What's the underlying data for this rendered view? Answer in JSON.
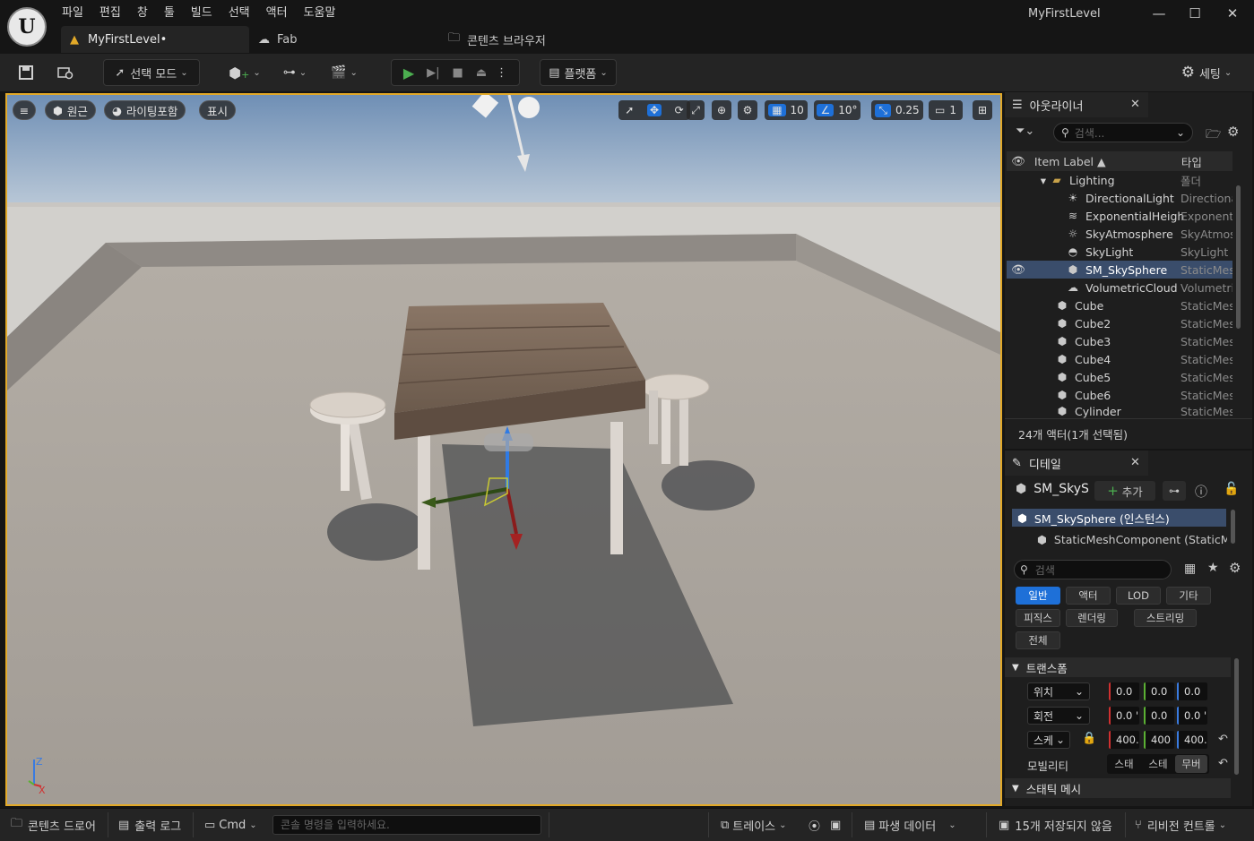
{
  "menu": [
    "파일",
    "편집",
    "창",
    "툴",
    "빌드",
    "선택",
    "액터",
    "도움말"
  ],
  "tabs": {
    "level": "MyFirstLevel•",
    "fab": "Fab",
    "content_browser": "콘텐츠 브라우저"
  },
  "window_title": "MyFirstLevel",
  "window_buttons": {
    "minimize": "—",
    "maximize": "☐",
    "close": "✕"
  },
  "toolbar": {
    "select_mode": "선택 모드",
    "platform": "플랫폼",
    "settings": "세팅"
  },
  "viewport": {
    "perspective": "원근",
    "lighting": "라이팅포함",
    "show": "표시",
    "grid_snap": "10",
    "rotate_snap": "10°",
    "scale_snap": "0.25",
    "camera_speed": "1",
    "axis_z": "Z",
    "axis_x": "X"
  },
  "outliner": {
    "title": "아웃라이너",
    "search_placeholder": "검색...",
    "col_label": "Item Label ▲",
    "col_type": "타입",
    "rows": [
      {
        "label": "Lighting",
        "type": "폴더",
        "icon": "folder-icon"
      },
      {
        "label": "DirectionalLight",
        "type": "Directiona",
        "icon": "sun-icon"
      },
      {
        "label": "ExponentialHeigh",
        "type": "Exponenti",
        "icon": "fog-icon"
      },
      {
        "label": "SkyAtmosphere",
        "type": "SkyAtmos",
        "icon": "atmosphere-icon"
      },
      {
        "label": "SkyLight",
        "type": "SkyLight",
        "icon": "skylight-icon"
      },
      {
        "label": "SM_SkySphere",
        "type": "StaticMes",
        "icon": "mesh-icon",
        "selected": true
      },
      {
        "label": "VolumetricCloud",
        "type": "Volumetric",
        "icon": "cloud-icon"
      },
      {
        "label": "Cube",
        "type": "StaticMes",
        "icon": "mesh-icon"
      },
      {
        "label": "Cube2",
        "type": "StaticMes",
        "icon": "mesh-icon"
      },
      {
        "label": "Cube3",
        "type": "StaticMes",
        "icon": "mesh-icon"
      },
      {
        "label": "Cube4",
        "type": "StaticMes",
        "icon": "mesh-icon"
      },
      {
        "label": "Cube5",
        "type": "StaticMes",
        "icon": "mesh-icon"
      },
      {
        "label": "Cube6",
        "type": "StaticMes",
        "icon": "mesh-icon"
      },
      {
        "label": "Cylinder",
        "type": "StaticMes",
        "icon": "mesh-icon"
      }
    ],
    "footer": "24개 액터(1개 선택됨)"
  },
  "details": {
    "title": "디테일",
    "actor_name": "SM_SkyS",
    "add_label": "추가",
    "instance": "SM_SkySphere (인스턴스)",
    "component": "StaticMeshComponent (StaticMe",
    "search_placeholder": "검색",
    "filters": [
      "일반",
      "액터",
      "LOD",
      "기타",
      "피직스",
      "렌더링",
      "스트리밍",
      "전체"
    ],
    "transform_section": "트랜스폼",
    "location_label": "위치",
    "rotation_label": "회전",
    "scale_label": "스케",
    "location": [
      "0.0",
      "0.0",
      "0.0"
    ],
    "rotation": [
      "0.0 '",
      "0.0",
      "0.0 '"
    ],
    "scale": [
      "400.",
      "400",
      "400."
    ],
    "mobility_label": "모빌리티",
    "mobility_options": [
      "스태",
      "스테",
      "무버"
    ],
    "static_mesh_section": "스태틱 메시"
  },
  "statusbar": {
    "content_drawer": "콘텐츠 드로어",
    "output_log": "출력 로그",
    "cmd": "Cmd",
    "console_placeholder": "콘솔 명령을 입력하세요.",
    "trace": "트레이스",
    "derived_data": "파생 데이터",
    "unsaved": "15개 저장되지 않음",
    "revision_control": "리비전 컨트롤"
  }
}
